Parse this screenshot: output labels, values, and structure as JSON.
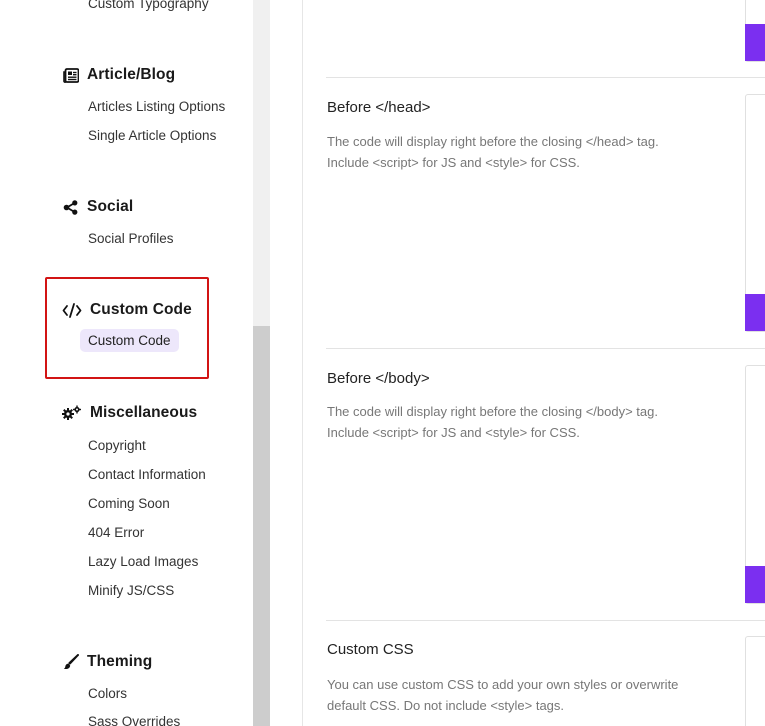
{
  "sidebar": {
    "partial_item": "Custom Typography",
    "sections": [
      {
        "title": "Article/Blog",
        "icon": "newspaper-icon",
        "items": [
          "Articles Listing Options",
          "Single Article Options"
        ]
      },
      {
        "title": "Social",
        "icon": "share-icon",
        "items": [
          "Social Profiles"
        ]
      },
      {
        "title": "Custom Code",
        "icon": "code-icon",
        "items": [
          "Custom Code"
        ]
      },
      {
        "title": "Miscellaneous",
        "icon": "gears-icon",
        "items": [
          "Copyright",
          "Contact Information",
          "Coming Soon",
          "404 Error",
          "Lazy Load Images",
          "Minify JS/CSS"
        ]
      },
      {
        "title": "Theming",
        "icon": "brush-icon",
        "items": [
          "Colors",
          "Sass Overrides"
        ]
      }
    ],
    "active_item": "Custom Code"
  },
  "fields": [
    {
      "title": "Before </head>",
      "desc_line1": "The code will display right before the closing </head> tag.",
      "desc_line2": "Include <script> for JS and <style> for CSS."
    },
    {
      "title": "Before </body>",
      "desc_line1": "The code will display right before the closing </body> tag.",
      "desc_line2": "Include <script> for JS and <style> for CSS."
    },
    {
      "title": "Custom CSS",
      "desc_line1": "You can use custom CSS to add your own styles or overwrite",
      "desc_line2": "default CSS. Do not include <style> tags."
    }
  ],
  "colors": {
    "accent": "#7b2ff0",
    "active_bg": "#ede7fb",
    "highlight": "#d21414"
  }
}
